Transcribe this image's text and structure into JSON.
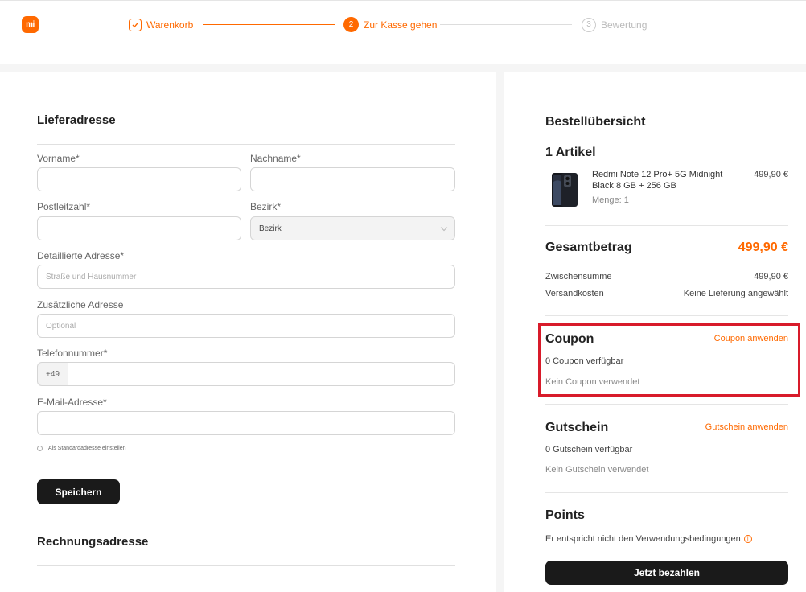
{
  "brand": {
    "logo_text": "mi",
    "accent": "#ff6900"
  },
  "steps": [
    {
      "number": "1",
      "label": "Warenkorb",
      "state": "done"
    },
    {
      "number": "2",
      "label": "Zur Kasse gehen",
      "state": "active"
    },
    {
      "number": "3",
      "label": "Bewertung",
      "state": "pending"
    }
  ],
  "shipping": {
    "title": "Lieferadresse",
    "first_name_label": "Vorname*",
    "last_name_label": "Nachname*",
    "zip_label": "Postleitzahl*",
    "district_label": "Bezirk*",
    "district_value": "Bezirk",
    "address_label": "Detaillierte Adresse*",
    "address_placeholder": "Straße und Hausnummer",
    "extra_label": "Zusätzliche Adresse",
    "extra_placeholder": "Optional",
    "phone_label": "Telefonnummer*",
    "phone_prefix": "+49",
    "email_label": "E-Mail-Adresse*",
    "default_label": "Als Standardadresse einstellen",
    "save_label": "Speichern"
  },
  "billing": {
    "title": "Rechnungsadresse"
  },
  "summary": {
    "title": "Bestellübersicht",
    "count": "1 Artikel",
    "item": {
      "name_line1": "Redmi Note 12 Pro+ 5G Midnight",
      "name_line2": "Black 8 GB + 256 GB",
      "qty": "Menge: 1",
      "price": "499,90 €"
    },
    "total_label": "Gesamtbetrag",
    "total_value": "499,90 €",
    "subtotal_label": "Zwischensumme",
    "subtotal_value": "499,90 €",
    "shipping_label": "Versandkosten",
    "shipping_value": "Keine Lieferung angewählt"
  },
  "coupon": {
    "title": "Coupon",
    "apply": "Coupon anwenden",
    "available": "0 Coupon verfügbar",
    "used": "Kein Coupon verwendet"
  },
  "voucher": {
    "title": "Gutschein",
    "apply": "Gutschein anwenden",
    "available": "0 Gutschein verfügbar",
    "used": "Kein Gutschein verwendet"
  },
  "points": {
    "title": "Points",
    "note": "Er entspricht nicht den Verwendungsbedingungen",
    "info_symbol": "i"
  },
  "pay_label": "Jetzt bezahlen"
}
